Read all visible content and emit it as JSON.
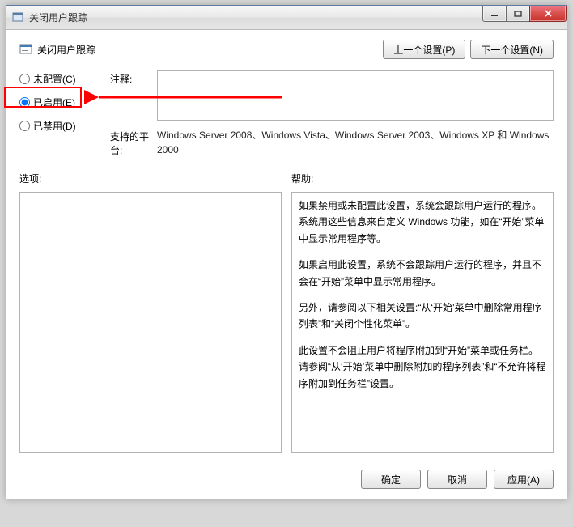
{
  "window": {
    "title": "关闭用户跟踪"
  },
  "header": {
    "title": "关闭用户跟踪",
    "prev": "上一个设置(P)",
    "next": "下一个设置(N)"
  },
  "radios": {
    "not_configured": "未配置(C)",
    "enabled": "已启用(E)",
    "disabled": "已禁用(D)"
  },
  "labels": {
    "comment": "注释:",
    "supported": "支持的平台:",
    "options": "选项:",
    "help": "帮助:"
  },
  "supported_platforms": "Windows Server 2008、Windows Vista、Windows Server 2003、Windows XP 和 Windows 2000",
  "help": {
    "p1": "如果禁用或未配置此设置，系统会跟踪用户运行的程序。系统用这些信息来自定义 Windows 功能，如在“开始”菜单中显示常用程序等。",
    "p2": "如果启用此设置，系统不会跟踪用户运行的程序，并且不会在“开始”菜单中显示常用程序。",
    "p3": "另外，请参阅以下相关设置:“从‘开始’菜单中删除常用程序列表”和“关闭个性化菜单”。",
    "p4": "此设置不会阻止用户将程序附加到“开始”菜单或任务栏。请参阅“从‘开始’菜单中删除附加的程序列表”和“不允许将程序附加到任务栏”设置。"
  },
  "footer": {
    "ok": "确定",
    "cancel": "取消",
    "apply": "应用(A)"
  }
}
